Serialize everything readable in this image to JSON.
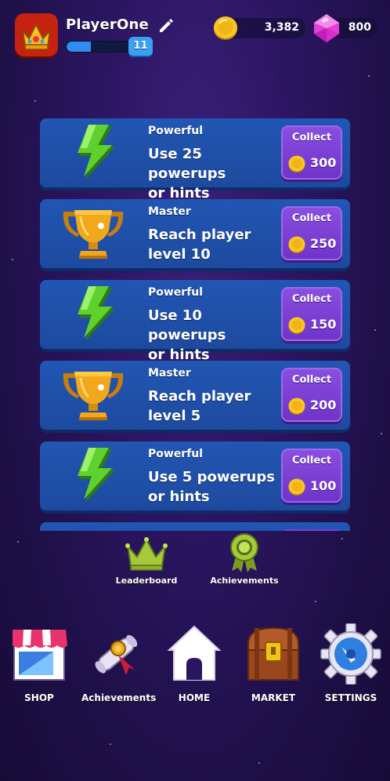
{
  "player": {
    "name": "PlayerOne",
    "level": "11",
    "xp_progress_percent": 38
  },
  "currency": {
    "coins": "3,382",
    "gems": "800"
  },
  "achievements": [
    {
      "category": "Powerful",
      "line1": "Use 25 powerups",
      "line2": "or hints",
      "button": "Collect",
      "reward": "300",
      "icon": "lightning-bolt-icon"
    },
    {
      "category": "Master",
      "line1": "Reach player",
      "line2": "level 10",
      "button": "Collect",
      "reward": "250",
      "icon": "trophy-icon"
    },
    {
      "category": "Powerful",
      "line1": "Use 10 powerups",
      "line2": "or hints",
      "button": "Collect",
      "reward": "150",
      "icon": "lightning-bolt-icon"
    },
    {
      "category": "Master",
      "line1": "Reach player",
      "line2": "level 5",
      "button": "Collect",
      "reward": "200",
      "icon": "trophy-icon"
    },
    {
      "category": "Powerful",
      "line1": "Use 5 powerups",
      "line2": "or hints",
      "button": "Collect",
      "reward": "100",
      "icon": "lightning-bolt-icon"
    }
  ],
  "subnav": {
    "leaderboard": "Leaderboard",
    "achievements": "Achievements"
  },
  "bottom_nav": {
    "shop": "SHOP",
    "achievements": "Achievements",
    "home": "HOME",
    "market": "MARKET",
    "settings": "SETTINGS"
  },
  "colors": {
    "card": "#2156b3",
    "collect_button": "#7a3fd6",
    "bolt": "#5fd12f",
    "trophy": "#f2a81d",
    "background": "#2a1560"
  }
}
